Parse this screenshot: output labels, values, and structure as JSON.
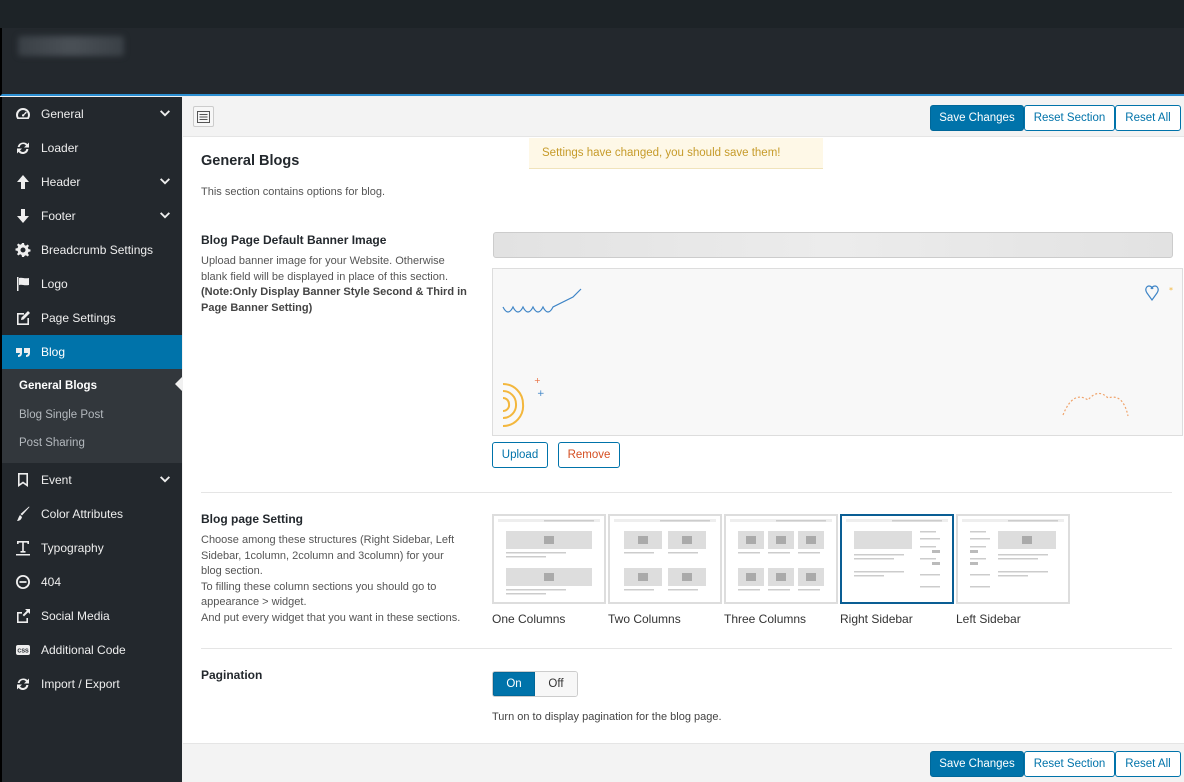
{
  "sidebar": {
    "items": [
      {
        "label": "General",
        "icon": "gauge-icon",
        "has_children": true
      },
      {
        "label": "Loader",
        "icon": "refresh-icon",
        "has_children": false
      },
      {
        "label": "Header",
        "icon": "arrow-up-icon",
        "has_children": true
      },
      {
        "label": "Footer",
        "icon": "arrow-down-icon",
        "has_children": true
      },
      {
        "label": "Breadcrumb Settings",
        "icon": "gear-icon",
        "has_children": false
      },
      {
        "label": "Logo",
        "icon": "flag-icon",
        "has_children": false
      },
      {
        "label": "Page Settings",
        "icon": "edit-icon",
        "has_children": false
      },
      {
        "label": "Blog",
        "icon": "quote-icon",
        "has_children": false,
        "active": true
      }
    ],
    "blog_sub": [
      "General Blogs",
      "Blog Single Post",
      "Post Sharing"
    ],
    "items_after": [
      {
        "label": "Event",
        "icon": "bookmark-icon",
        "has_children": true
      },
      {
        "label": "Color Attributes",
        "icon": "brush-icon",
        "has_children": false
      },
      {
        "label": "Typography",
        "icon": "text-icon",
        "has_children": false
      },
      {
        "label": "404",
        "icon": "minus-circle-icon",
        "has_children": false
      },
      {
        "label": "Social Media",
        "icon": "share-icon",
        "has_children": false
      },
      {
        "label": "Additional Code",
        "icon": "css-icon",
        "has_children": false
      },
      {
        "label": "Import / Export",
        "icon": "refresh-icon",
        "has_children": false
      }
    ]
  },
  "toolbar": {
    "save_label": "Save Changes",
    "reset_section_label": "Reset Section",
    "reset_all_label": "Reset All"
  },
  "notice": "Settings have changed, you should save them!",
  "section": {
    "title": "General Blogs",
    "description": "This section contains options for blog."
  },
  "banner_field": {
    "title": "Blog Page Default Banner Image",
    "desc_line1": "Upload banner image for your Website. Otherwise",
    "desc_line2": "blank field will be displayed in place of this section.",
    "note_line1": "(Note:Only Display Banner Style Second & Third in",
    "note_line2": "Page Banner Setting)",
    "upload_label": "Upload",
    "remove_label": "Remove"
  },
  "layout_field": {
    "title": "Blog page Setting",
    "desc": [
      "Choose among these structures (Right Sidebar, Left",
      "Sidebar, 1column, 2column and 3column) for your",
      "blog section.",
      "To filling these column sections you should go to",
      "appearance > widget.",
      "And put every widget that you want in these sections."
    ],
    "options": [
      "One Columns",
      "Two Columns",
      "Three Columns",
      "Right Sidebar",
      "Left Sidebar"
    ],
    "selected": "Right Sidebar"
  },
  "pagination_field": {
    "title": "Pagination",
    "on_label": "On",
    "off_label": "Off",
    "help": "Turn on to display pagination for the blog page."
  },
  "colors": {
    "accent": "#0073aa",
    "sidebar_bg": "#23282d",
    "notice_text": "#c69b2a"
  }
}
